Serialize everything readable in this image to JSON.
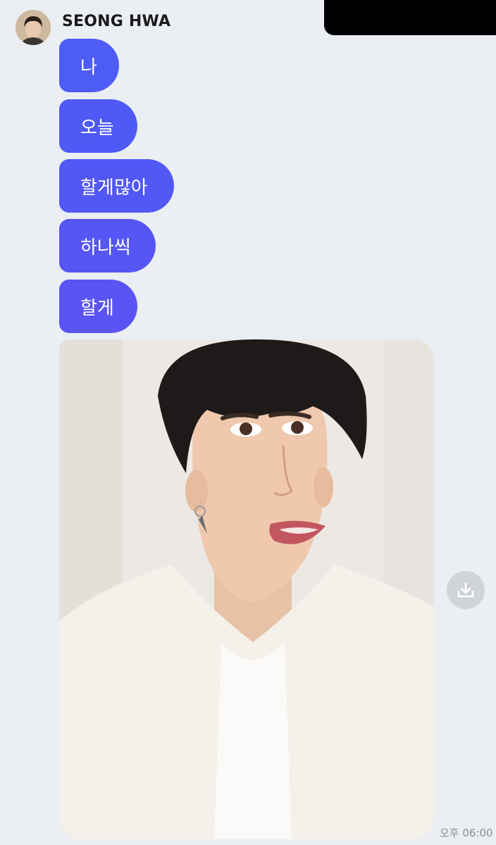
{
  "sender": {
    "name": "SEONG HWA",
    "avatar_icon": "profile-photo"
  },
  "messages": [
    {
      "text": "나",
      "color": "#4d5cf6"
    },
    {
      "text": "오늘",
      "color": "#4f5af6"
    },
    {
      "text": "할게많아",
      "color": "#5258f6"
    },
    {
      "text": "하나씩",
      "color": "#5656f5"
    },
    {
      "text": "할게",
      "color": "#5a54f5"
    }
  ],
  "photo_message": {
    "download_icon": "download-icon"
  },
  "timestamp": "오후 06:00",
  "colors": {
    "background": "#ebeef2",
    "bubble_start": "#4d5cf6",
    "bubble_end": "#5a54f5"
  }
}
